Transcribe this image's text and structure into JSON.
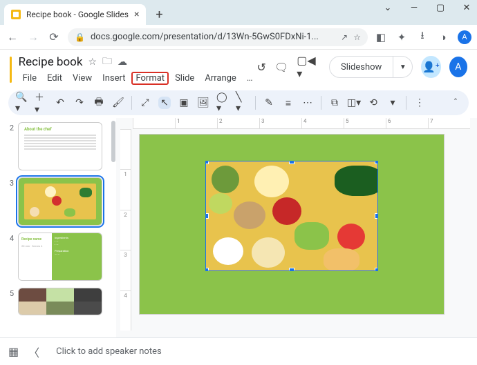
{
  "browser": {
    "tab_title": "Recipe book - Google Slides",
    "url": "docs.google.com/presentation/d/13Wn-5GwS0FDxNi-1...",
    "window_min": "—",
    "window_max": "▢",
    "window_close": "✕",
    "avatar_letter": "A"
  },
  "doc": {
    "title": "Recipe book",
    "menus": [
      "File",
      "Edit",
      "View",
      "Insert",
      "Format",
      "Slide",
      "Arrange",
      "…"
    ],
    "highlighted_menu_index": 4,
    "slideshow_label": "Slideshow",
    "avatar_letter": "A"
  },
  "ruler_h": [
    "",
    "1",
    "2",
    "3",
    "4",
    "5",
    "6",
    "7"
  ],
  "ruler_v": [
    "",
    "1",
    "2",
    "3",
    "4"
  ],
  "filmstrip": {
    "slides": [
      {
        "num": "2",
        "title": "About the chef"
      },
      {
        "num": "3"
      },
      {
        "num": "4",
        "recipe": "Recipe name",
        "sub": "20 min · Serves 4",
        "ing_head": "Ingredients",
        "prep_head": "Preparation"
      },
      {
        "num": "5"
      }
    ],
    "selected_index": 1
  },
  "notes": {
    "placeholder": "Click to add speaker notes"
  }
}
